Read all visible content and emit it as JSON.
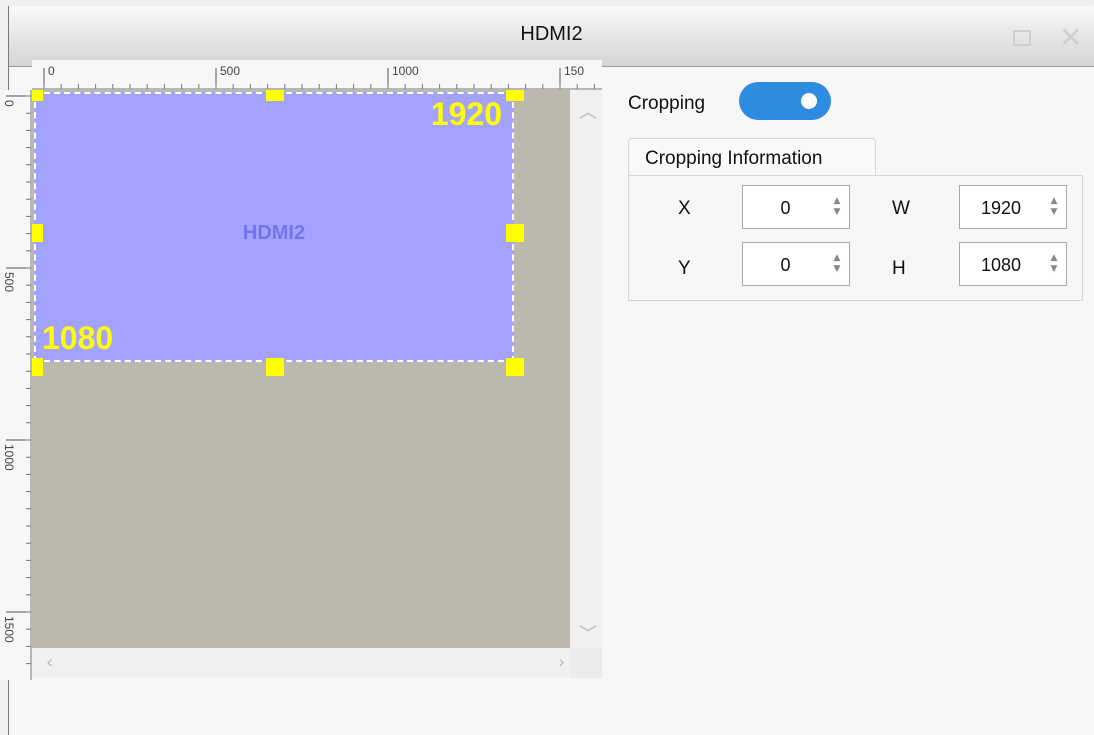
{
  "window": {
    "title": "HDMI2"
  },
  "ruler": {
    "top_ticks": [
      "0",
      "500",
      "1000",
      "150"
    ],
    "left_ticks": [
      "0",
      "500",
      "1000",
      "1500"
    ]
  },
  "canvas": {
    "crop_label": "HDMI2",
    "width_label": "1920",
    "height_label": "1080",
    "crop_fill": "#a3a3ff",
    "background": "#bbb9ad",
    "handle_color": "#ffff00"
  },
  "cropping": {
    "label": "Cropping",
    "enabled": true,
    "accent": "#2e8ce0"
  },
  "info": {
    "tab_label": "Cropping Information",
    "x_label": "X",
    "x_value": "0",
    "y_label": "Y",
    "y_value": "0",
    "w_label": "W",
    "w_value": "1920",
    "h_label": "H",
    "h_value": "1080"
  },
  "icons": {
    "maximize": "maximize-icon",
    "close": "close-icon",
    "scroll_up": "chevron-up-icon",
    "scroll_down": "chevron-down-icon",
    "scroll_left": "chevron-left-icon",
    "scroll_right": "chevron-right-icon",
    "spin": "spin-arrows-icon"
  }
}
